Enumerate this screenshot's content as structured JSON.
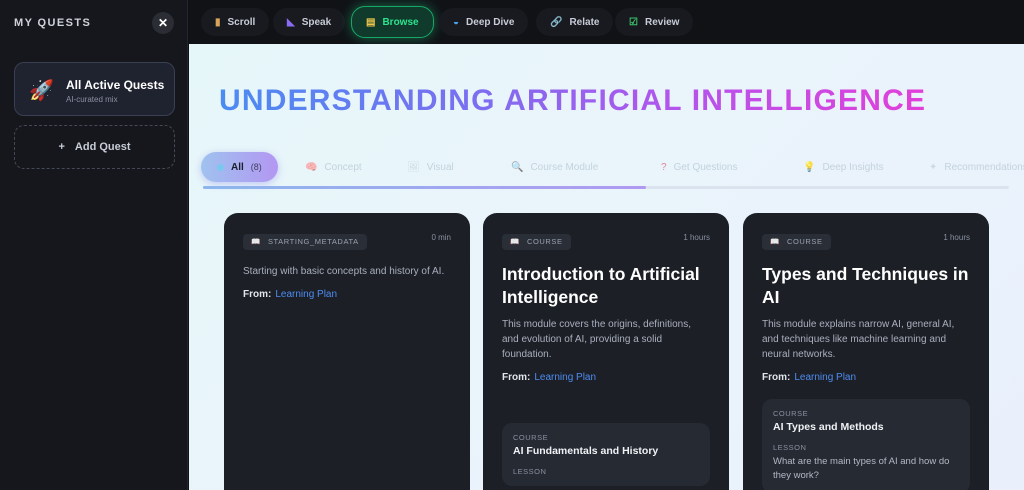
{
  "sidebar": {
    "title": "MY QUESTS",
    "close_label": "✕",
    "active_quest": {
      "title": "All Active Quests",
      "subtitle": "AI-curated mix"
    },
    "add_quest": {
      "plus": "+",
      "label": "Add Quest"
    }
  },
  "tabs": [
    {
      "label": "Scroll",
      "icon": "scroll-icon"
    },
    {
      "label": "Speak",
      "icon": "speak-icon"
    },
    {
      "label": "Browse",
      "icon": "browse-icon",
      "active": true
    },
    {
      "label": "Deep Dive",
      "icon": "deep-dive-icon"
    },
    {
      "label": "Relate",
      "icon": "link-icon"
    },
    {
      "label": "Review",
      "icon": "check-icon"
    }
  ],
  "page": {
    "title": "UNDERSTANDING ARTIFICIAL INTELLIGENCE"
  },
  "filters": [
    {
      "label": "All",
      "count": "(8)",
      "active": true
    },
    {
      "label": "Concept"
    },
    {
      "label": "Visual"
    },
    {
      "label": "Course Module"
    },
    {
      "label": "Get Questions"
    },
    {
      "label": "Deep Insights"
    },
    {
      "label": "Recommendations"
    }
  ],
  "cards": [
    {
      "type": "STARTING_METADATA",
      "duration": "0 min",
      "description": "Starting with basic concepts and history of AI.",
      "from_label": "From:",
      "from_link": "Learning Plan"
    },
    {
      "type": "COURSE",
      "duration": "1 hours",
      "title": "Introduction to Artificial Intelligence",
      "description": "This module covers the origins, definitions, and evolution of AI, providing a solid foundation.",
      "from_label": "From:",
      "from_link": "Learning Plan",
      "sub": {
        "course_key": "COURSE",
        "course_title": "AI Fundamentals and History",
        "lesson_key": "LESSON"
      }
    },
    {
      "type": "COURSE",
      "duration": "1 hours",
      "title": "Types and Techniques in AI",
      "description": "This module explains narrow AI, general AI, and techniques like machine learning and neural networks.",
      "from_label": "From:",
      "from_link": "Learning Plan",
      "sub": {
        "course_key": "COURSE",
        "course_title": "AI Types and Methods",
        "lesson_key": "LESSON",
        "lesson_question": "What are the main types of AI and how do they work?"
      }
    }
  ],
  "colors": {
    "accent_green": "#2ee38f",
    "link_blue": "#4e8cf0",
    "title_gradient_start": "#4a8cf2",
    "title_gradient_end": "#e23fd9"
  }
}
